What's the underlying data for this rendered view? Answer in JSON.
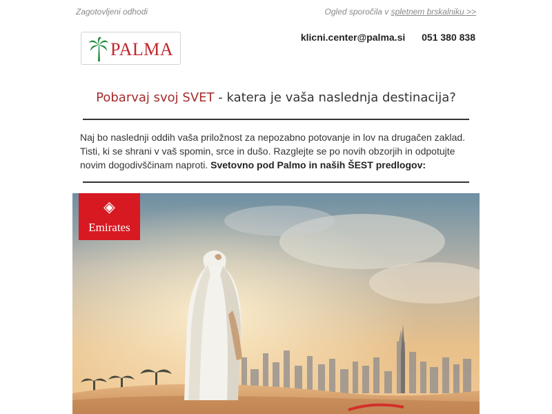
{
  "topbar": {
    "left_text": "Zagotovljeni odhodi",
    "right_text": "Ogled sporočila v",
    "right_link": "spletnem brskalniku >>"
  },
  "logo": {
    "text": "PALMA"
  },
  "contact": {
    "email": "klicni.center@palma.si",
    "phone": "051 380 838"
  },
  "headline": {
    "accent": "Pobarvaj svoj SVET",
    "rest": " - katera je vaša naslednja destinacija?"
  },
  "intro": {
    "text": "Naj bo naslednji oddih vaša priložnost za nepozabno potovanje in lov na drugačen zaklad. Tisti, ki se shrani v vaš spomin, srce in dušo. Razglejte se po novih obzorjih in odpotujte novim dogodivščinam naproti. ",
    "bold": "Svetovno pod Palmo in naših ŠEST predlogov:"
  },
  "hero": {
    "brand": "Emirates"
  },
  "colors": {
    "accent": "#a52a2a",
    "emirates_red": "#d71921",
    "palma_red": "#c0262d",
    "palm_green": "#1f8a3a"
  }
}
